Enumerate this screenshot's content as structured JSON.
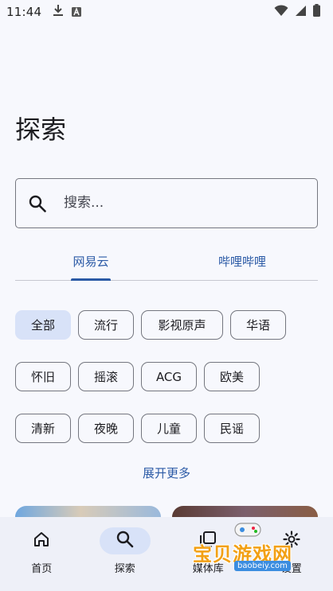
{
  "status_bar": {
    "time": "11:44"
  },
  "page": {
    "title": "探索"
  },
  "search": {
    "placeholder": "搜索..."
  },
  "tabs": [
    {
      "label": "网易云",
      "active": true
    },
    {
      "label": "哔哩哔哩",
      "active": false
    }
  ],
  "chips": {
    "row1": [
      "全部",
      "流行",
      "影视原声",
      "华语"
    ],
    "row2": [
      "怀旧",
      "摇滚",
      "ACG",
      "欧美"
    ],
    "row3": [
      "清新",
      "夜晚",
      "儿童",
      "民谣"
    ],
    "selected": "全部"
  },
  "expand_more": "展开更多",
  "bottom_nav": [
    {
      "label": "首页",
      "icon": "home-icon",
      "active": false
    },
    {
      "label": "探索",
      "icon": "search-icon",
      "active": true
    },
    {
      "label": "媒体库",
      "icon": "library-icon",
      "active": false
    },
    {
      "label": "设置",
      "icon": "gear-icon",
      "active": false
    }
  ],
  "watermark": {
    "text": "宝贝游戏网",
    "url": "baobeiy.com"
  },
  "colors": {
    "accent": "#2b5aa6",
    "selected_chip": "#d8e2f8",
    "background": "#f7f8fd"
  }
}
